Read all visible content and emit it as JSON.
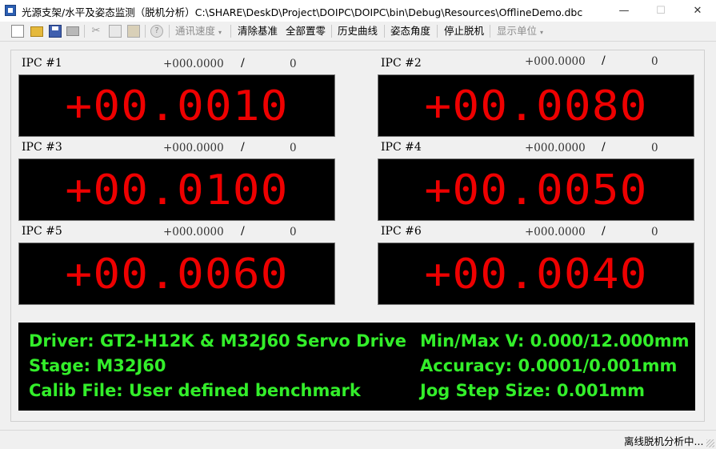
{
  "window": {
    "title": "光源支架/水平及姿态监测（脱机分析）C:\\SHARE\\DeskD\\Project\\DOIPC\\DOIPC\\bin\\Debug\\Resources\\OfflineDemo.dbc",
    "minimize_glyph": "—",
    "maximize_glyph": "☐",
    "close_glyph": "✕"
  },
  "toolbar": {
    "help_glyph": "?",
    "cut_glyph": "✂",
    "comm_speed": "通讯速度",
    "clear_baseline": "清除基准",
    "zero_all": "全部置零",
    "history_curve": "历史曲线",
    "attitude_angle": "姿态角度",
    "stop_offline": "停止脱机",
    "display_unit": "显示单位",
    "dropdown_glyph": "▾"
  },
  "ipcs": [
    {
      "label": "IPC #1",
      "value": "+000.0000",
      "sep": "/",
      "count": "0",
      "display": "+00.0010"
    },
    {
      "label": "IPC #2",
      "value": "+000.0000",
      "sep": "/",
      "count": "0",
      "display": "+00.0080"
    },
    {
      "label": "IPC #3",
      "value": "+000.0000",
      "sep": "/",
      "count": "0",
      "display": "+00.0100"
    },
    {
      "label": "IPC #4",
      "value": "+000.0000",
      "sep": "/",
      "count": "0",
      "display": "+00.0050"
    },
    {
      "label": "IPC #5",
      "value": "+000.0000",
      "sep": "/",
      "count": "0",
      "display": "+00.0060"
    },
    {
      "label": "IPC #6",
      "value": "+000.0000",
      "sep": "/",
      "count": "0",
      "display": "+00.0040"
    }
  ],
  "info": {
    "driver": "Driver: GT2-H12K & M32J60 Servo Drive",
    "stage": "Stage: M32J60",
    "calib_file": "Calib File: User defined benchmark",
    "minmax": "Min/Max V: 0.000/12.000mm",
    "accuracy": "Accuracy: 0.0001/0.001mm",
    "jog_step": "Jog Step Size: 0.001mm"
  },
  "status": {
    "text": "离线脱机分析中..."
  },
  "colors": {
    "display_bg": "#000000",
    "display_digits": "#ee0000",
    "info_text": "#33ee2a"
  }
}
